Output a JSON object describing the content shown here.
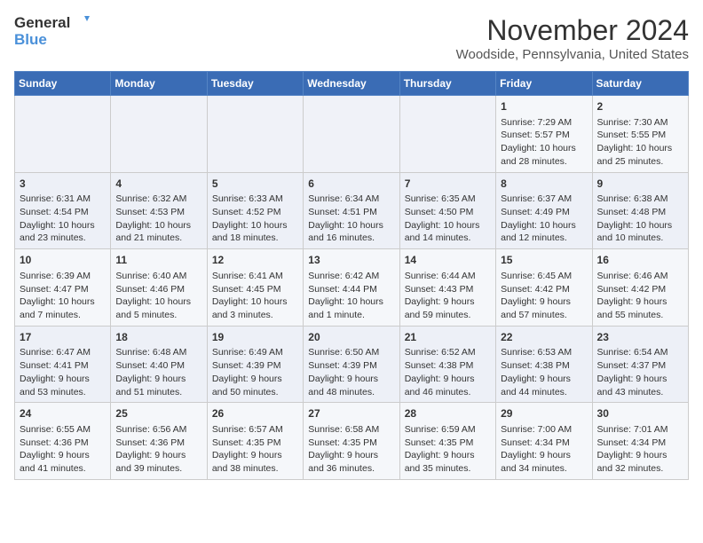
{
  "logo": {
    "line1": "General",
    "line2": "Blue"
  },
  "title": "November 2024",
  "location": "Woodside, Pennsylvania, United States",
  "weekdays": [
    "Sunday",
    "Monday",
    "Tuesday",
    "Wednesday",
    "Thursday",
    "Friday",
    "Saturday"
  ],
  "weeks": [
    [
      {
        "day": "",
        "info": ""
      },
      {
        "day": "",
        "info": ""
      },
      {
        "day": "",
        "info": ""
      },
      {
        "day": "",
        "info": ""
      },
      {
        "day": "",
        "info": ""
      },
      {
        "day": "1",
        "info": "Sunrise: 7:29 AM\nSunset: 5:57 PM\nDaylight: 10 hours\nand 28 minutes."
      },
      {
        "day": "2",
        "info": "Sunrise: 7:30 AM\nSunset: 5:55 PM\nDaylight: 10 hours\nand 25 minutes."
      }
    ],
    [
      {
        "day": "3",
        "info": "Sunrise: 6:31 AM\nSunset: 4:54 PM\nDaylight: 10 hours\nand 23 minutes."
      },
      {
        "day": "4",
        "info": "Sunrise: 6:32 AM\nSunset: 4:53 PM\nDaylight: 10 hours\nand 21 minutes."
      },
      {
        "day": "5",
        "info": "Sunrise: 6:33 AM\nSunset: 4:52 PM\nDaylight: 10 hours\nand 18 minutes."
      },
      {
        "day": "6",
        "info": "Sunrise: 6:34 AM\nSunset: 4:51 PM\nDaylight: 10 hours\nand 16 minutes."
      },
      {
        "day": "7",
        "info": "Sunrise: 6:35 AM\nSunset: 4:50 PM\nDaylight: 10 hours\nand 14 minutes."
      },
      {
        "day": "8",
        "info": "Sunrise: 6:37 AM\nSunset: 4:49 PM\nDaylight: 10 hours\nand 12 minutes."
      },
      {
        "day": "9",
        "info": "Sunrise: 6:38 AM\nSunset: 4:48 PM\nDaylight: 10 hours\nand 10 minutes."
      }
    ],
    [
      {
        "day": "10",
        "info": "Sunrise: 6:39 AM\nSunset: 4:47 PM\nDaylight: 10 hours\nand 7 minutes."
      },
      {
        "day": "11",
        "info": "Sunrise: 6:40 AM\nSunset: 4:46 PM\nDaylight: 10 hours\nand 5 minutes."
      },
      {
        "day": "12",
        "info": "Sunrise: 6:41 AM\nSunset: 4:45 PM\nDaylight: 10 hours\nand 3 minutes."
      },
      {
        "day": "13",
        "info": "Sunrise: 6:42 AM\nSunset: 4:44 PM\nDaylight: 10 hours\nand 1 minute."
      },
      {
        "day": "14",
        "info": "Sunrise: 6:44 AM\nSunset: 4:43 PM\nDaylight: 9 hours\nand 59 minutes."
      },
      {
        "day": "15",
        "info": "Sunrise: 6:45 AM\nSunset: 4:42 PM\nDaylight: 9 hours\nand 57 minutes."
      },
      {
        "day": "16",
        "info": "Sunrise: 6:46 AM\nSunset: 4:42 PM\nDaylight: 9 hours\nand 55 minutes."
      }
    ],
    [
      {
        "day": "17",
        "info": "Sunrise: 6:47 AM\nSunset: 4:41 PM\nDaylight: 9 hours\nand 53 minutes."
      },
      {
        "day": "18",
        "info": "Sunrise: 6:48 AM\nSunset: 4:40 PM\nDaylight: 9 hours\nand 51 minutes."
      },
      {
        "day": "19",
        "info": "Sunrise: 6:49 AM\nSunset: 4:39 PM\nDaylight: 9 hours\nand 50 minutes."
      },
      {
        "day": "20",
        "info": "Sunrise: 6:50 AM\nSunset: 4:39 PM\nDaylight: 9 hours\nand 48 minutes."
      },
      {
        "day": "21",
        "info": "Sunrise: 6:52 AM\nSunset: 4:38 PM\nDaylight: 9 hours\nand 46 minutes."
      },
      {
        "day": "22",
        "info": "Sunrise: 6:53 AM\nSunset: 4:38 PM\nDaylight: 9 hours\nand 44 minutes."
      },
      {
        "day": "23",
        "info": "Sunrise: 6:54 AM\nSunset: 4:37 PM\nDaylight: 9 hours\nand 43 minutes."
      }
    ],
    [
      {
        "day": "24",
        "info": "Sunrise: 6:55 AM\nSunset: 4:36 PM\nDaylight: 9 hours\nand 41 minutes."
      },
      {
        "day": "25",
        "info": "Sunrise: 6:56 AM\nSunset: 4:36 PM\nDaylight: 9 hours\nand 39 minutes."
      },
      {
        "day": "26",
        "info": "Sunrise: 6:57 AM\nSunset: 4:35 PM\nDaylight: 9 hours\nand 38 minutes."
      },
      {
        "day": "27",
        "info": "Sunrise: 6:58 AM\nSunset: 4:35 PM\nDaylight: 9 hours\nand 36 minutes."
      },
      {
        "day": "28",
        "info": "Sunrise: 6:59 AM\nSunset: 4:35 PM\nDaylight: 9 hours\nand 35 minutes."
      },
      {
        "day": "29",
        "info": "Sunrise: 7:00 AM\nSunset: 4:34 PM\nDaylight: 9 hours\nand 34 minutes."
      },
      {
        "day": "30",
        "info": "Sunrise: 7:01 AM\nSunset: 4:34 PM\nDaylight: 9 hours\nand 32 minutes."
      }
    ]
  ]
}
